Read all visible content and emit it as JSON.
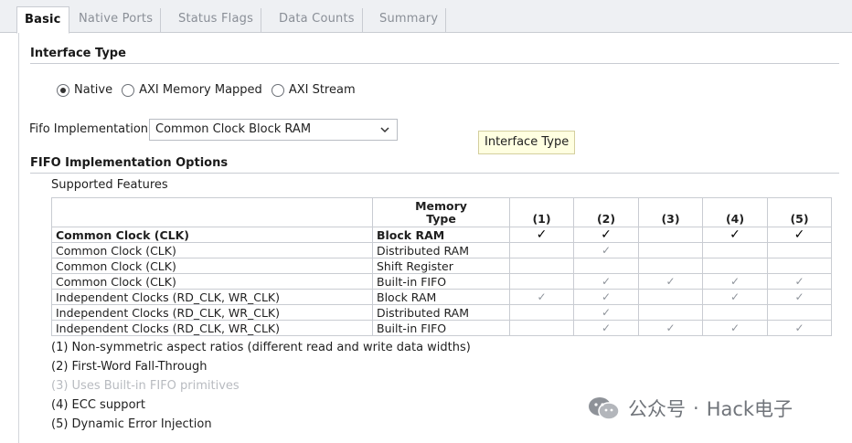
{
  "tabs": [
    {
      "label": "Basic",
      "active": true
    },
    {
      "label": "Native Ports",
      "active": false
    },
    {
      "label": "Status Flags",
      "active": false
    },
    {
      "label": "Data Counts",
      "active": false
    },
    {
      "label": "Summary",
      "active": false
    }
  ],
  "interface": {
    "title": "Interface Type",
    "options": [
      {
        "label": "Native",
        "selected": true
      },
      {
        "label": "AXI Memory Mapped",
        "selected": false
      },
      {
        "label": "AXI Stream",
        "selected": false
      }
    ]
  },
  "fifo": {
    "label": "Fifo Implementation",
    "value": "Common Clock Block RAM"
  },
  "tooltip": "Interface Type",
  "options_section": {
    "title": "FIFO Implementation Options",
    "supported_label": "Supported Features"
  },
  "table": {
    "header": {
      "memory_line1": "Memory",
      "memory_line2": "Type",
      "cols": [
        "(1)",
        "(2)",
        "(3)",
        "(4)",
        "(5)"
      ]
    },
    "check_glyph": "✓",
    "rows": [
      {
        "clock": "Common Clock (CLK)",
        "memory": "Block RAM",
        "checks": [
          true,
          true,
          false,
          true,
          true
        ],
        "highlight": true
      },
      {
        "clock": "Common Clock (CLK)",
        "memory": "Distributed RAM",
        "checks": [
          false,
          true,
          false,
          false,
          false
        ],
        "highlight": false
      },
      {
        "clock": "Common Clock (CLK)",
        "memory": "Shift Register",
        "checks": [
          false,
          false,
          false,
          false,
          false
        ],
        "highlight": false
      },
      {
        "clock": "Common Clock (CLK)",
        "memory": "Built-in FIFO",
        "checks": [
          false,
          true,
          true,
          true,
          true
        ],
        "highlight": false
      },
      {
        "clock": "Independent Clocks (RD_CLK, WR_CLK)",
        "memory": "Block RAM",
        "checks": [
          true,
          true,
          false,
          true,
          true
        ],
        "highlight": false
      },
      {
        "clock": "Independent Clocks (RD_CLK, WR_CLK)",
        "memory": "Distributed RAM",
        "checks": [
          false,
          true,
          false,
          false,
          false
        ],
        "highlight": false
      },
      {
        "clock": "Independent Clocks (RD_CLK, WR_CLK)",
        "memory": "Built-in FIFO",
        "checks": [
          false,
          true,
          true,
          true,
          true
        ],
        "highlight": false
      }
    ]
  },
  "footnotes": [
    {
      "text": "(1) Non-symmetric aspect ratios (different read and write data widths)",
      "dim": false
    },
    {
      "text": "(2) First-Word Fall-Through",
      "dim": false
    },
    {
      "text": "(3) Uses Built-in FIFO primitives",
      "dim": true
    },
    {
      "text": "(4) ECC support",
      "dim": false
    },
    {
      "text": "(5) Dynamic Error Injection",
      "dim": false
    }
  ],
  "watermark": {
    "left": "公众号",
    "dot": "·",
    "right": "Hack电子"
  }
}
